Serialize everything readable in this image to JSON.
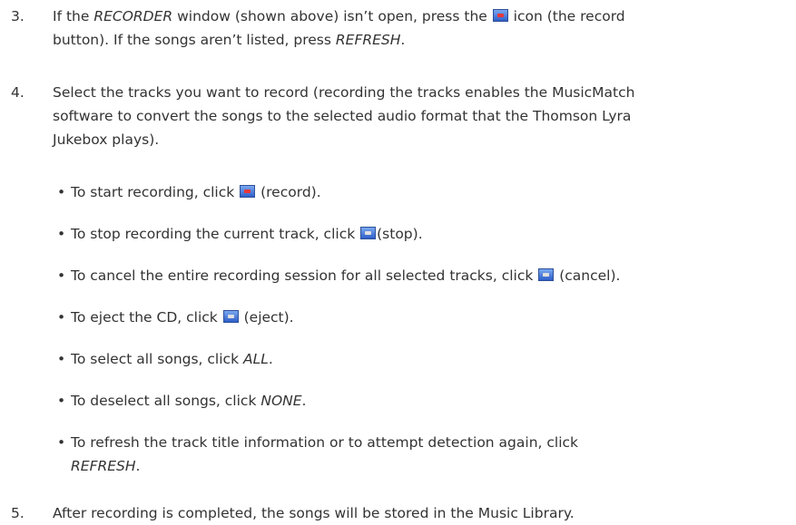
{
  "step3": {
    "num": "3.",
    "l1a": "If the ",
    "l1b": "RECORDER",
    "l1c": " window (shown above) isn’t open, press the ",
    "l1d": " icon (the record",
    "l2a": "button). If the songs aren’t listed, press ",
    "l2b": "REFRESH",
    "l2c": "."
  },
  "step4": {
    "num": "4.",
    "l1": "Select the tracks you want to record (recording the tracks enables the MusicMatch",
    "l2": "software to convert the songs to the selected audio format that the Thomson Lyra",
    "l3": "Jukebox plays)."
  },
  "bullets": {
    "dot": "•",
    "b1a": "To start recording, click ",
    "b1b": " (record).",
    "b2a": "To stop recording the current track, click ",
    "b2b": "(stop).",
    "b3a": "To cancel the entire recording session for all selected tracks, click ",
    "b3b": " (cancel).",
    "b4a": "To eject the CD, click ",
    "b4b": " (eject).",
    "b5a": "To select all songs, click ",
    "b5b": "ALL",
    "b5c": ".",
    "b6a": "To deselect all songs, click ",
    "b6b": "NONE",
    "b6c": ".",
    "b7a": "To refresh the track title information or to attempt detection again, click",
    "b7b": "REFRESH",
    "b7c": "."
  },
  "step5": {
    "num": "5.",
    "l1": "After recording is completed, the songs will be stored in the Music Library."
  },
  "icons": {
    "record": "record-icon",
    "stop": "stop-icon",
    "cancel": "cancel-icon",
    "eject": "eject-icon"
  }
}
